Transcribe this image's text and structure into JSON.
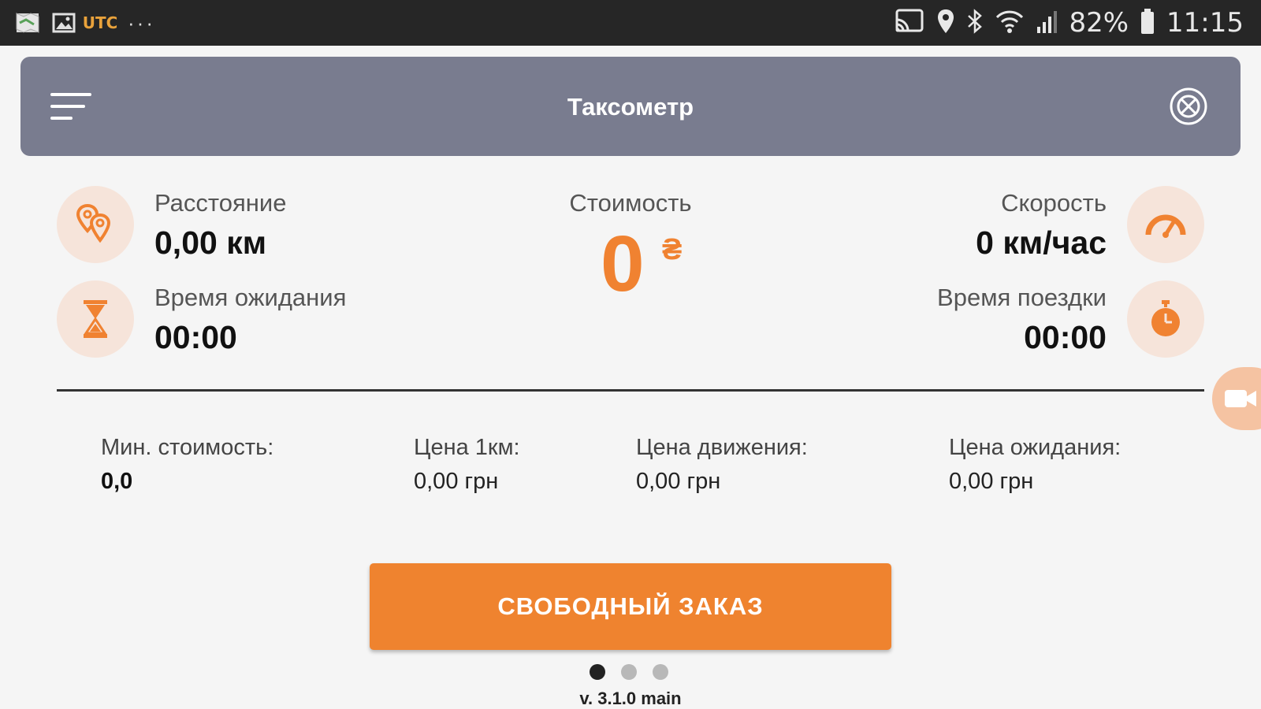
{
  "status_bar": {
    "left_icons": [
      "map-icon",
      "gallery-icon",
      "utc-app-icon"
    ],
    "utc_label": "UTC",
    "more_label": "···",
    "right_icons": [
      "cast-icon",
      "location-icon",
      "bluetooth-icon",
      "wifi-icon",
      "signal-icon"
    ],
    "battery": "82%",
    "time": "11:15"
  },
  "header": {
    "title": "Таксометр",
    "menu_icon": "menu-icon",
    "close_icon": "close-circle-icon"
  },
  "metrics": {
    "distance": {
      "label": "Расстояние",
      "value": "0,00 км",
      "icon": "map-pins-icon"
    },
    "wait_time": {
      "label": "Время ожидания",
      "value": "00:00",
      "icon": "hourglass-icon"
    },
    "cost": {
      "label": "Стоимость",
      "value": "0",
      "currency": "₴"
    },
    "speed": {
      "label": "Скорость",
      "value": "0 км/час",
      "icon": "speedometer-icon"
    },
    "trip_time": {
      "label": "Время поездки",
      "value": "00:00",
      "icon": "stopwatch-icon"
    }
  },
  "tariff": {
    "min_cost": {
      "label": "Мин. стоимость:",
      "value": "0,0"
    },
    "price_km": {
      "label": "Цена 1км:",
      "value": "0,00 грн"
    },
    "price_move": {
      "label": "Цена движения:",
      "value": "0,00 грн"
    },
    "price_wait": {
      "label": "Цена ожидания:",
      "value": "0,00 грн"
    }
  },
  "actions": {
    "free_order": "СВОБОДНЫЙ ЗАКАЗ"
  },
  "pager": {
    "count": 3,
    "active": 1
  },
  "version": "v. 3.1.0 main",
  "colors": {
    "accent": "#ef832f",
    "header": "#797c8f",
    "icon_bg": "#f6e4da",
    "background": "#f5f5f5"
  }
}
